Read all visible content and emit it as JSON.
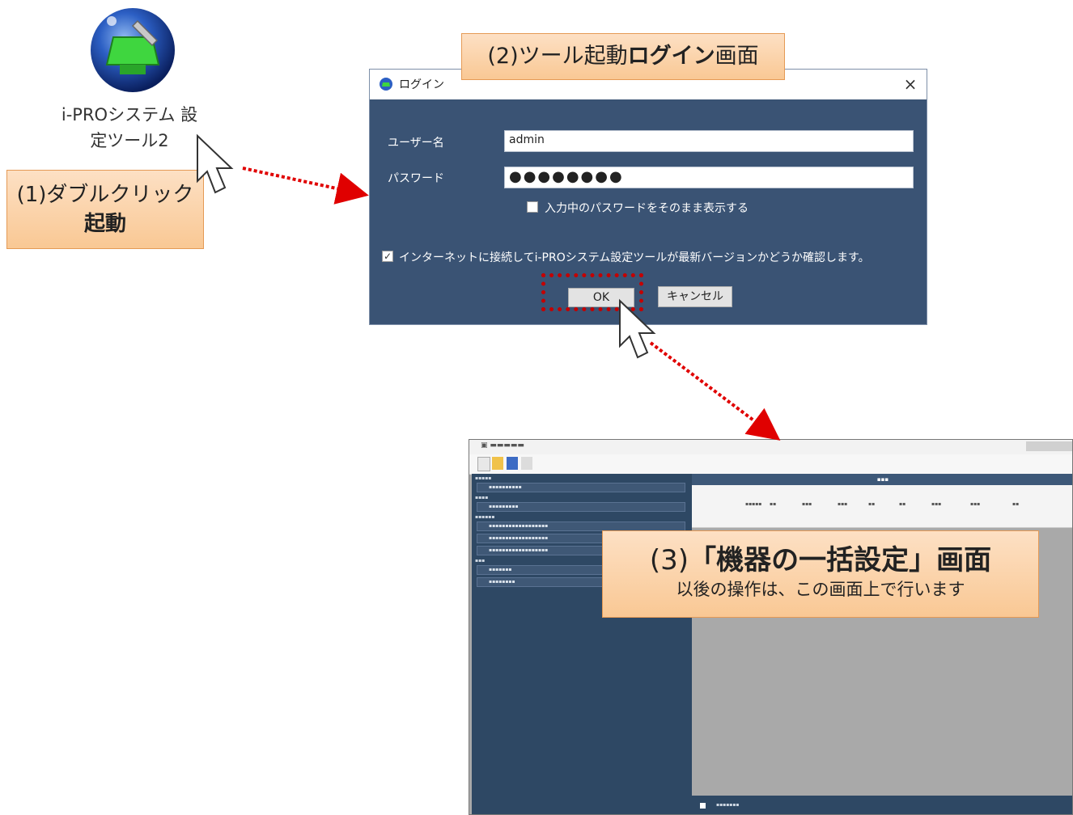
{
  "desktop": {
    "icon_name": "i-pro-setup-tool-icon",
    "icon_label_line1": "i-PROシステム 設",
    "icon_label_line2": "定ツール2"
  },
  "callouts": {
    "step1_line1": "(1)ダブルクリック",
    "step1_line2": "起動",
    "step2_prefix": "(2)ツール起動",
    "step2_bold": "ログイン",
    "step2_suffix": "画面",
    "step3_prefix": "(3)",
    "step3_bold": "「機器の一括設定」画面",
    "step3_sub": "以後の操作は、この画面上で行います"
  },
  "login": {
    "title": "ログイン",
    "close": "×",
    "username_label": "ユーザー名",
    "username_value": "admin",
    "password_label": "パスワード",
    "password_value": "●●●●●●●●",
    "show_password_label": "入力中のパスワードをそのまま表示する",
    "show_password_checked": false,
    "update_check_label": "インターネットに接続してi-PROシステム設定ツールが最新バージョンかどうか確認します。",
    "update_check_checked": true,
    "ok_label": "OK",
    "cancel_label": "キャンセル"
  },
  "colors": {
    "dialog_bg": "#3a5374",
    "callout_bg": "#f9c894",
    "highlight_red": "#c40000"
  }
}
